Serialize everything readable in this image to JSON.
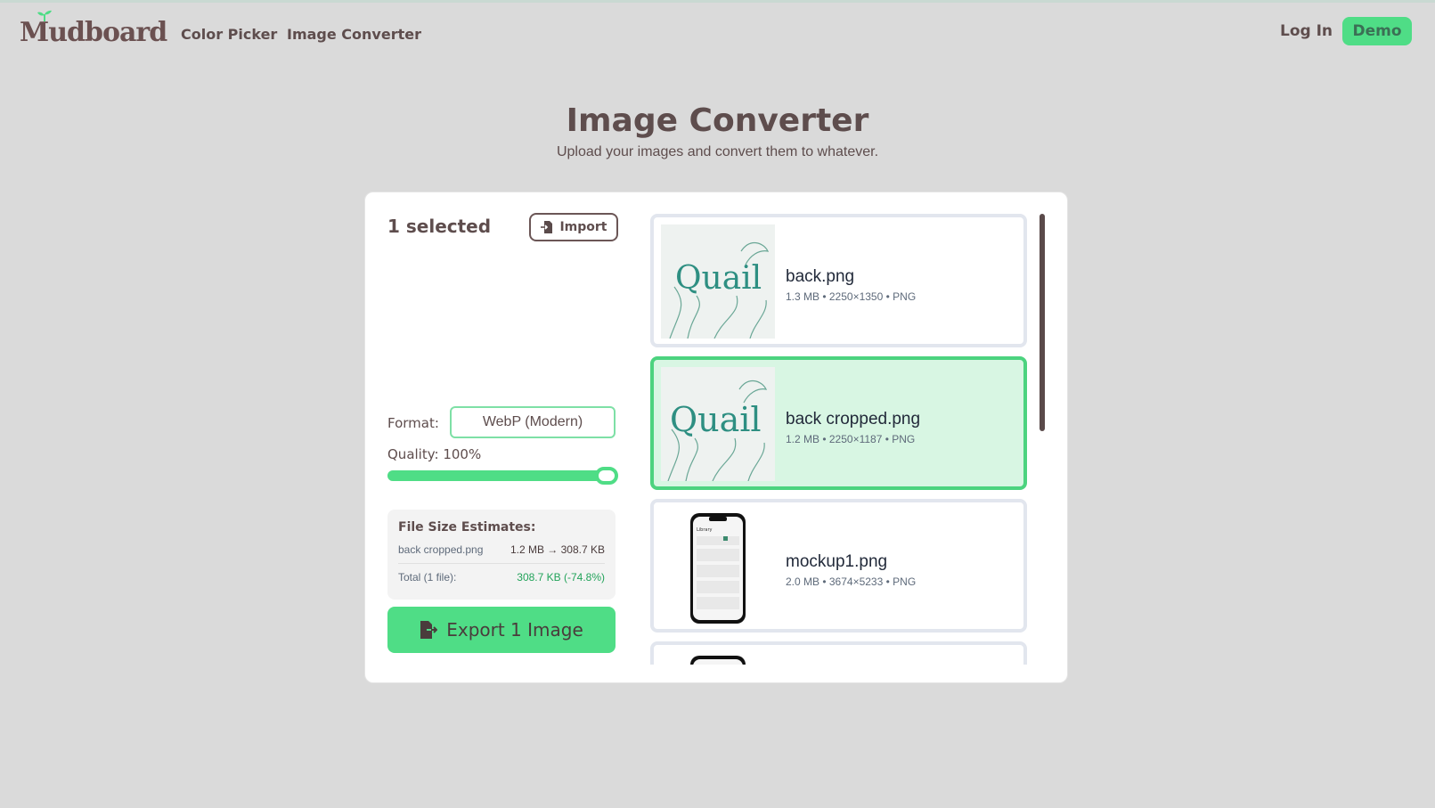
{
  "header": {
    "logo": "Mudboard",
    "nav": [
      "Color Picker",
      "Image Converter"
    ],
    "login": "Log In",
    "demo": "Demo"
  },
  "page": {
    "title": "Image Converter",
    "subtitle": "Upload your images and convert them to whatever."
  },
  "panel": {
    "selected_count": "1 selected",
    "import_label": "Import",
    "format_label": "Format:",
    "format_value": "WebP (Modern)",
    "quality_label": "Quality: 100%",
    "quality_fraction": 1.0,
    "estimates": {
      "title": "File Size Estimates:",
      "rows": [
        {
          "name": "back cropped.png",
          "value": "1.2 MB → 308.7 KB"
        }
      ],
      "total_label": "Total (1 file):",
      "total_value": "308.7 KB (-74.8%)"
    },
    "export_label": "Export 1 Image"
  },
  "images": [
    {
      "name": "back.png",
      "meta": "1.3 MB • 2250×1350 • PNG",
      "selected": false,
      "thumb_text": "Quail"
    },
    {
      "name": "back cropped.png",
      "meta": "1.2 MB • 2250×1187 • PNG",
      "selected": true,
      "thumb_text": "Quail"
    },
    {
      "name": "mockup1.png",
      "meta": "2.0 MB • 3674×5233 • PNG",
      "selected": false,
      "thumb_text": "Library"
    }
  ],
  "colors": {
    "accent": "#4fdd86",
    "selected_bg": "#d8f6e3",
    "text": "#5e4d4d"
  }
}
